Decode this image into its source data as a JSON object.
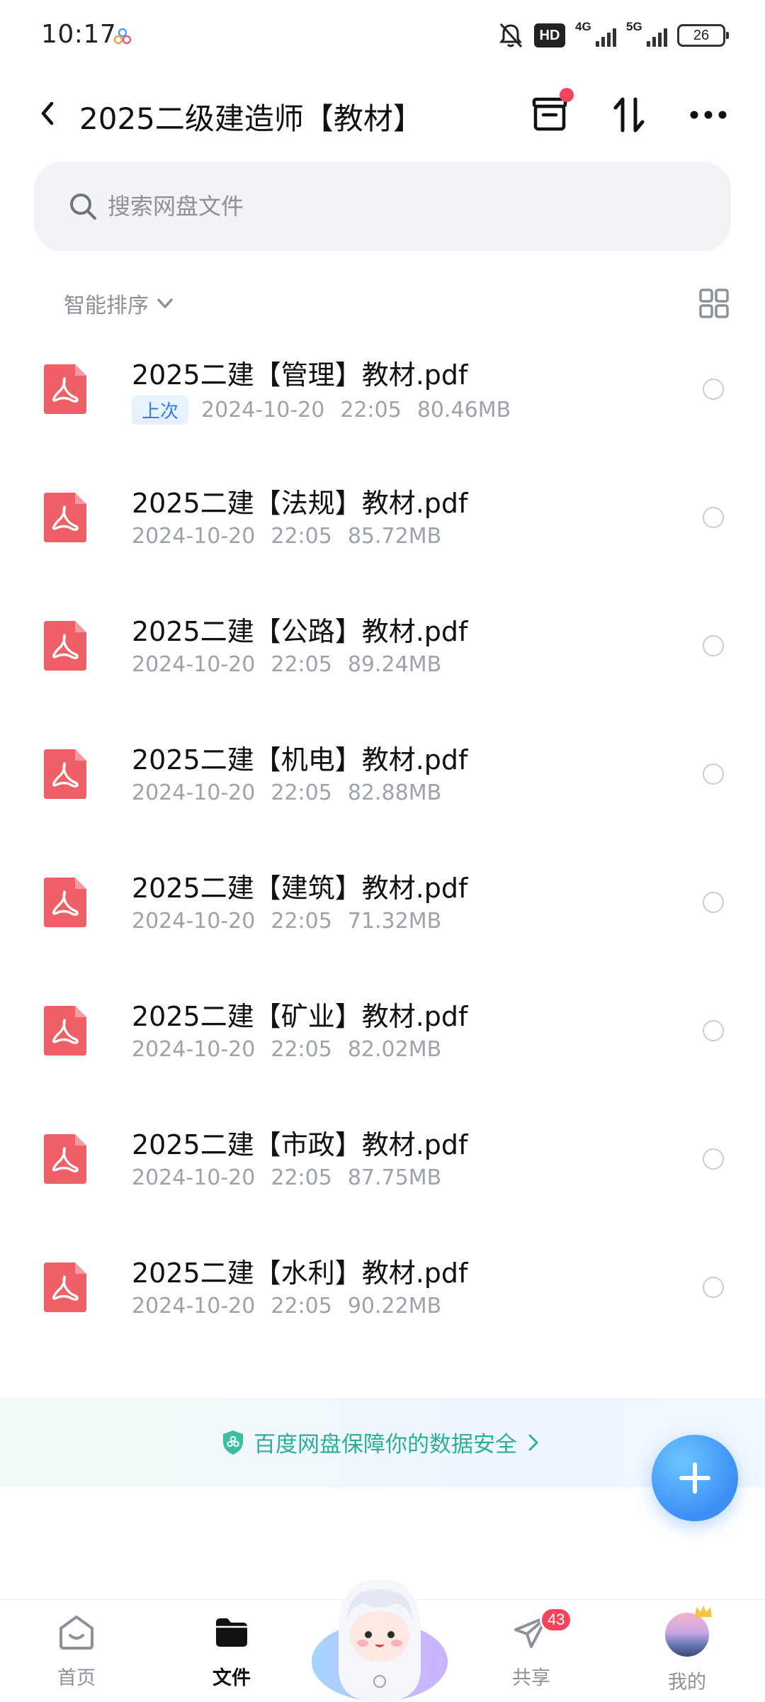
{
  "status_bar": {
    "time": "10:17",
    "hd": "HD",
    "net1": "4G",
    "net2": "5G",
    "battery": "26"
  },
  "header": {
    "title": "2025二级建造师【教材】",
    "back_icon": "chevron-left-icon",
    "archive_icon": "archive-box-icon",
    "sort_icon": "sort-arrows-icon",
    "more_icon": "more-dots-icon"
  },
  "search": {
    "placeholder": "搜索网盘文件"
  },
  "sort": {
    "label": "智能排序"
  },
  "files": [
    {
      "name": "2025二建【管理】教材.pdf",
      "tag": "上次",
      "date": "2024-10-20",
      "time": "22:05",
      "size": "80.46MB"
    },
    {
      "name": "2025二建【法规】教材.pdf",
      "date": "2024-10-20",
      "time": "22:05",
      "size": "85.72MB"
    },
    {
      "name": "2025二建【公路】教材.pdf",
      "date": "2024-10-20",
      "time": "22:05",
      "size": "89.24MB"
    },
    {
      "name": "2025二建【机电】教材.pdf",
      "date": "2024-10-20",
      "time": "22:05",
      "size": "82.88MB"
    },
    {
      "name": "2025二建【建筑】教材.pdf",
      "date": "2024-10-20",
      "time": "22:05",
      "size": "71.32MB"
    },
    {
      "name": "2025二建【矿业】教材.pdf",
      "date": "2024-10-20",
      "time": "22:05",
      "size": "82.02MB"
    },
    {
      "name": "2025二建【市政】教材.pdf",
      "date": "2024-10-20",
      "time": "22:05",
      "size": "87.75MB"
    },
    {
      "name": "2025二建【水利】教材.pdf",
      "date": "2024-10-20",
      "time": "22:05",
      "size": "90.22MB"
    }
  ],
  "security": {
    "text": "百度网盘保障你的数据安全"
  },
  "bottom_nav": {
    "items": [
      {
        "label": "首页"
      },
      {
        "label": "文件"
      },
      {
        "label": "共享",
        "badge": "43"
      },
      {
        "label": "我的"
      }
    ]
  },
  "colors": {
    "accent": "#3b8ff5",
    "pdf_red": "#ee5f66",
    "badge_red": "#f2455b",
    "security_green": "#2eae9a",
    "meta_gray": "#9ea2ab"
  }
}
